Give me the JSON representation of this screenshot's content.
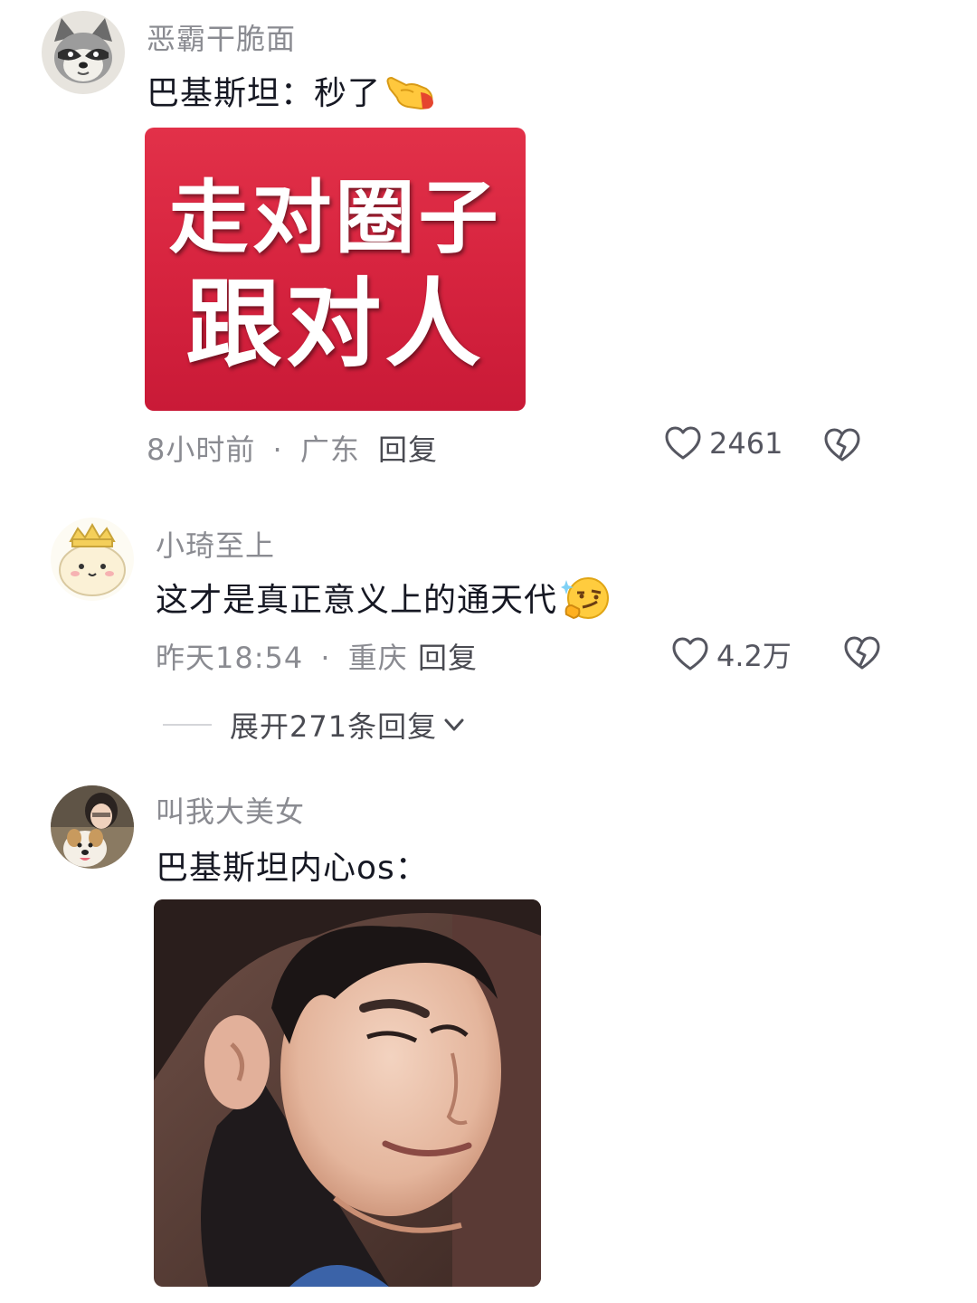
{
  "comments": [
    {
      "username": "恶霸干脆面",
      "text": "巴基斯坦：秒了",
      "emoji": "pointing-hand-emoji",
      "time": "8小时前",
      "location": "广东",
      "reply_label": "回复",
      "likes": "2461",
      "sticker": {
        "line1": "走对圈子",
        "line2": "跟对人"
      }
    },
    {
      "username": "小琦至上",
      "text": "这才是真正意义上的通天代",
      "emoji": "thinking-smirk-emoji",
      "time": "昨天18:54",
      "location": "重庆",
      "reply_label": "回复",
      "likes": "4.2万",
      "expand_label": "展开271条回复"
    },
    {
      "username": "叫我大美女",
      "text": "巴基斯坦内心os：",
      "photo": "smirking-man-photo"
    }
  ],
  "meta_separator": "·",
  "colors": {
    "text": "#161823",
    "muted": "#8a8b91",
    "sticker_red": "#d7243f"
  }
}
